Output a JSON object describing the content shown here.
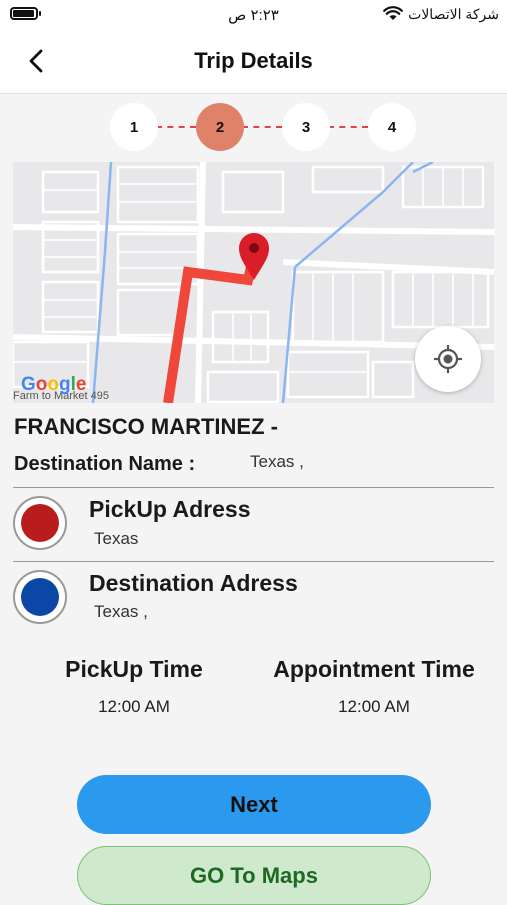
{
  "status_bar": {
    "time": "٢:٢٣ ص",
    "carrier": "شركة الاتصالات"
  },
  "header": {
    "title": "Trip Details"
  },
  "stepper": {
    "steps": [
      "1",
      "2",
      "3",
      "4"
    ],
    "active_step": 2
  },
  "map": {
    "attribution": "Google",
    "street_label": "Farm to Market 495"
  },
  "trip": {
    "passenger_name": "FRANCISCO MARTINEZ -",
    "destination_name_label": "Destination Name :",
    "destination_name_value": "Texas   ,"
  },
  "pickup": {
    "title": "PickUp Adress",
    "value": "Texas",
    "color": "#b81c1c"
  },
  "destination": {
    "title": "Destination Adress",
    "value": "Texas   ,",
    "color": "#0d47a6"
  },
  "times": {
    "pickup_label": "PickUp Time",
    "pickup_value": "12:00 AM",
    "appointment_label": "Appointment Time",
    "appointment_value": "12:00 AM"
  },
  "buttons": {
    "next": "Next",
    "go_to_maps": "GO To Maps"
  },
  "icons": {
    "back": "chevron-left-icon",
    "locate": "crosshair-icon",
    "map_pin": "map-pin-icon",
    "wifi": "wifi-icon",
    "battery": "battery-icon"
  },
  "colors": {
    "route": "#f0473b",
    "pin": "#d91e2a",
    "active_step": "#e0826a",
    "next_button": "#2b99ee",
    "maps_button": "#cfe9cd"
  }
}
